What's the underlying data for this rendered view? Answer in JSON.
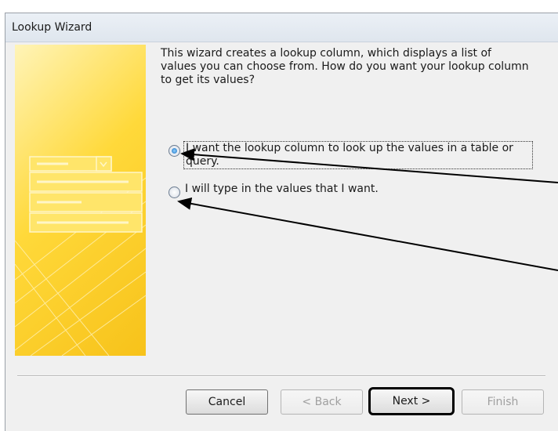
{
  "window": {
    "title": "Lookup Wizard"
  },
  "description": "This wizard creates a lookup column, which displays a list of values you can choose from.  How do you want your lookup column to get its values?",
  "options": [
    {
      "label": "I want the lookup column to look up the values in a table or query.",
      "checked": true
    },
    {
      "label": "I will type in the values that I want.",
      "checked": false
    }
  ],
  "buttons": {
    "cancel": "Cancel",
    "back": "< Back",
    "next": "Next >",
    "finish": "Finish"
  },
  "colors": {
    "accent_yellow": "#ffd93a",
    "highlight_border": "#000000"
  }
}
